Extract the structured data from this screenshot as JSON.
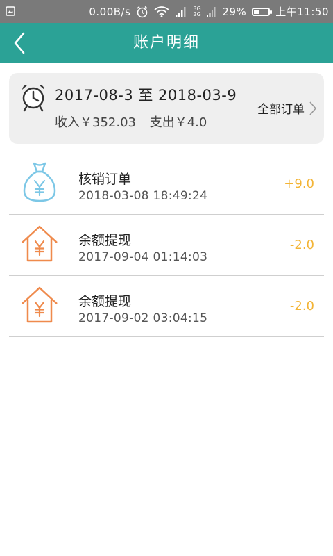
{
  "status_bar": {
    "speed": "0.00B/s",
    "network": "3G 2G",
    "battery": "29%",
    "battery_level": 0.29,
    "time": "上午11:50"
  },
  "header": {
    "title": "账户明细",
    "back_icon": "chevron-left-icon"
  },
  "summary": {
    "date_range": "2017-08-3 至 2018-03-9",
    "income": "收入￥352.03",
    "expense": "支出￥4.0",
    "all_orders_label": "全部订单",
    "icon": "alarm-clock-icon"
  },
  "transactions": [
    {
      "title": "核销订单",
      "time": "2018-03-08 18:49:24",
      "amount": "+9.0",
      "icon": "money-bag-icon"
    },
    {
      "title": "余额提现",
      "time": "2017-09-04 01:14:03",
      "amount": "-2.0",
      "icon": "house-yen-icon"
    },
    {
      "title": "余额提现",
      "time": "2017-09-02 03:04:15",
      "amount": "-2.0",
      "icon": "house-yen-icon"
    }
  ],
  "colors": {
    "header": "#2ba296",
    "amount": "#f3b435",
    "bag_icon": "#7cc7e6",
    "house_icon": "#ef8a4c"
  }
}
